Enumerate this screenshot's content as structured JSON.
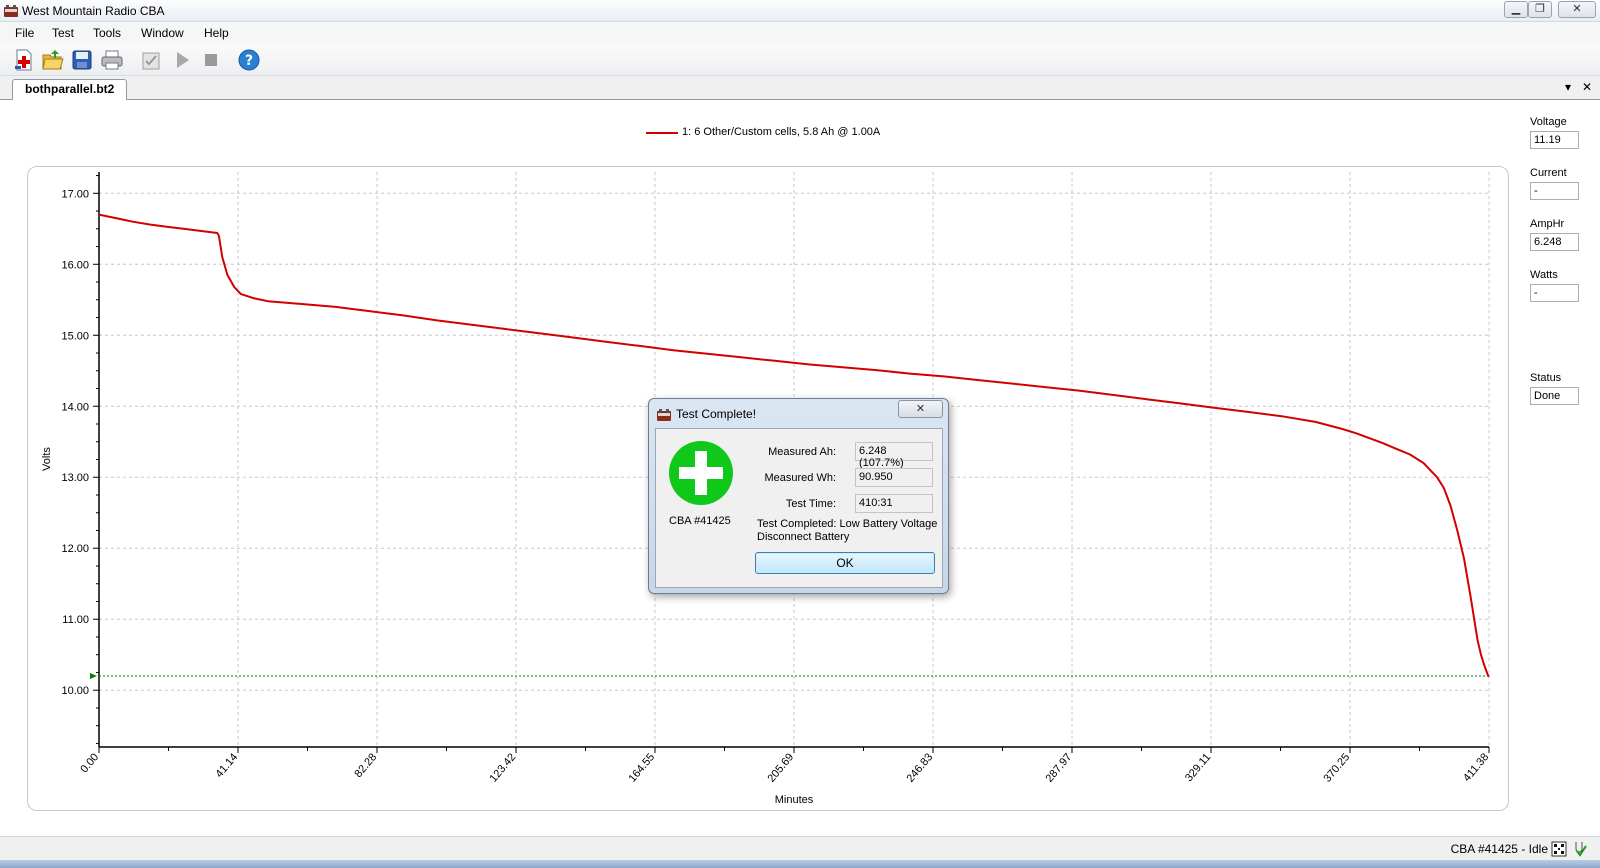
{
  "window": {
    "title": "West Mountain Radio CBA",
    "min": "▁",
    "restore": "❐",
    "close": "✕"
  },
  "menu": [
    "File",
    "Test",
    "Tools",
    "Window",
    "Help"
  ],
  "toolbar_icons": [
    "new-test-icon",
    "open-folder-icon",
    "save-icon",
    "print-icon",
    "checklist-icon",
    "play-icon",
    "stop-icon",
    "help-icon"
  ],
  "tab": {
    "label": "bothparallel.bt2",
    "dropdown": "▾",
    "close": "✕"
  },
  "side_panel": [
    {
      "label": "Voltage",
      "value": "11.19"
    },
    {
      "label": "Current",
      "value": "-"
    },
    {
      "label": "AmpHr",
      "value": "6.248"
    },
    {
      "label": "Watts",
      "value": "-"
    },
    {
      "label": "Status",
      "value": "Done"
    }
  ],
  "status_bar": {
    "text": "CBA #41425 - Idle"
  },
  "dialog": {
    "title": "Test Complete!",
    "close": "✕",
    "cba_id": "CBA #41425",
    "measured_ah_label": "Measured Ah:",
    "measured_ah": "6.248 (107.7%)",
    "measured_wh_label": "Measured Wh:",
    "measured_wh": "90.950",
    "test_time_label": "Test Time:",
    "test_time": "410:31",
    "message_line1": "Test Completed: Low Battery Voltage",
    "message_line2": "Disconnect Battery",
    "ok_label": "OK"
  },
  "colors": {
    "series": "#d40000",
    "cutoff": "#008000",
    "grid": "#c8c8c8",
    "ok_badge": "#00c000"
  },
  "chart_data": {
    "type": "line",
    "title": "",
    "xlabel": "Minutes",
    "ylabel": "Volts",
    "xlim": [
      0,
      411.38
    ],
    "ylim": [
      9.2,
      17.3
    ],
    "x_ticks": [
      0.0,
      41.14,
      82.28,
      123.42,
      164.55,
      205.69,
      246.83,
      287.97,
      329.11,
      370.25,
      411.38
    ],
    "x_tick_labels": [
      "0.00",
      "41.14",
      "82.28",
      "123.42",
      "164.55",
      "205.69",
      "246.83",
      "287.97",
      "329.11",
      "370.25",
      "411.38"
    ],
    "y_ticks": [
      10,
      11,
      12,
      13,
      14,
      15,
      16,
      17
    ],
    "y_tick_labels": [
      "10.00",
      "11.00",
      "12.00",
      "13.00",
      "14.00",
      "15.00",
      "16.00",
      "17.00"
    ],
    "grid": true,
    "legend": "top-center",
    "series": [
      {
        "name": "1: 6 Other/Custom cells, 5.8 Ah @ 1.00A",
        "x": [
          0,
          5,
          10,
          15,
          20,
          25,
          30,
          35,
          35.5,
          36.5,
          38,
          40,
          42,
          46,
          50,
          60,
          70,
          80,
          90,
          100,
          110,
          120,
          130,
          140,
          150,
          160,
          170,
          180,
          190,
          200,
          210,
          220,
          230,
          240,
          250,
          260,
          270,
          280,
          290,
          300,
          310,
          320,
          330,
          340,
          350,
          360,
          368,
          372,
          376,
          380,
          384,
          388,
          392,
          396,
          398,
          400,
          402,
          404,
          406,
          407,
          408,
          409,
          410,
          411,
          411.38
        ],
        "y": [
          16.7,
          16.65,
          16.6,
          16.56,
          16.53,
          16.5,
          16.47,
          16.44,
          16.4,
          16.1,
          15.85,
          15.68,
          15.58,
          15.52,
          15.48,
          15.44,
          15.4,
          15.34,
          15.28,
          15.21,
          15.15,
          15.09,
          15.03,
          14.97,
          14.91,
          14.85,
          14.79,
          14.74,
          14.69,
          14.64,
          14.59,
          14.55,
          14.51,
          14.46,
          14.42,
          14.37,
          14.32,
          14.27,
          14.22,
          14.16,
          14.1,
          14.04,
          13.98,
          13.92,
          13.86,
          13.78,
          13.68,
          13.62,
          13.55,
          13.48,
          13.4,
          13.32,
          13.2,
          13.0,
          12.85,
          12.6,
          12.25,
          11.85,
          11.3,
          11.0,
          10.7,
          10.5,
          10.35,
          10.22,
          10.19
        ]
      }
    ],
    "cutoff_voltage": 10.2
  }
}
